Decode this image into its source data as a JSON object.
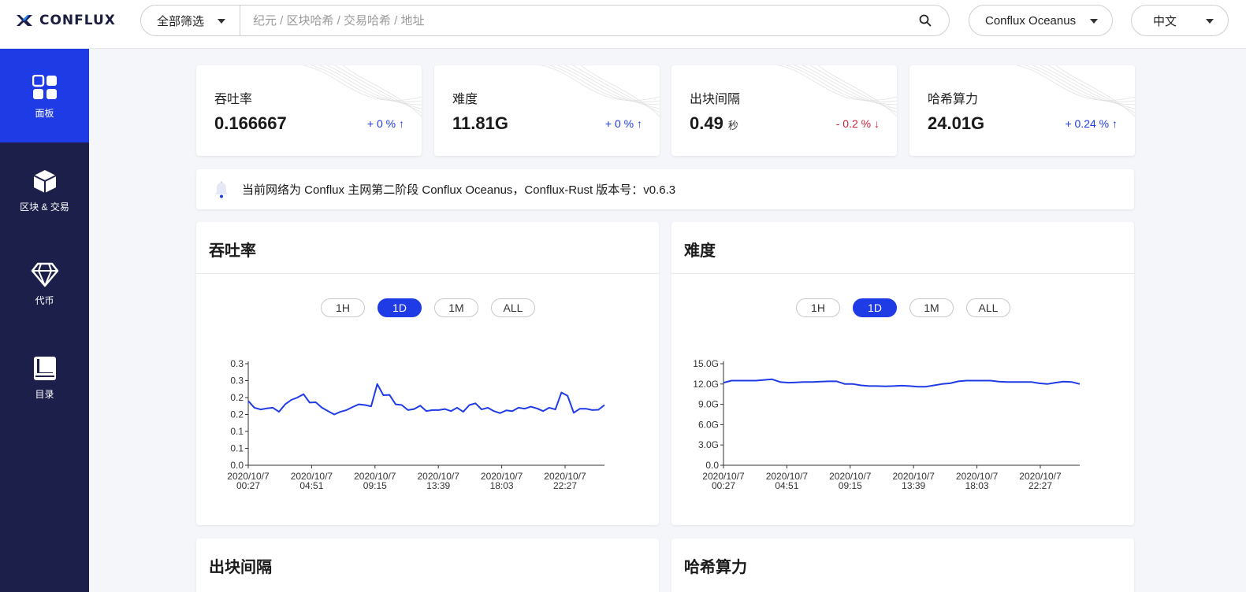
{
  "header": {
    "logo_text": "CONFLUX",
    "search_filter": "全部筛选",
    "search_placeholder": "纪元 / 区块哈希 / 交易哈希 / 地址",
    "network": "Conflux Oceanus",
    "language": "中文"
  },
  "sidebar": {
    "items": [
      {
        "label": "面板",
        "icon": "dashboard-icon",
        "active": true
      },
      {
        "label": "区块 & 交易",
        "icon": "cube-icon",
        "active": false
      },
      {
        "label": "代币",
        "icon": "diamond-icon",
        "active": false
      },
      {
        "label": "目录",
        "icon": "book-icon",
        "active": false
      }
    ]
  },
  "stats": [
    {
      "label": "吞吐率",
      "value": "0.166667",
      "unit": "",
      "change": "+ 0 % ↑",
      "direction": "up"
    },
    {
      "label": "难度",
      "value": "11.81G",
      "unit": "",
      "change": "+ 0 % ↑",
      "direction": "up"
    },
    {
      "label": "出块间隔",
      "value": "0.49",
      "unit": "秒",
      "change": "- 0.2 % ↓",
      "direction": "down"
    },
    {
      "label": "哈希算力",
      "value": "24.01G",
      "unit": "",
      "change": "+ 0.24 % ↑",
      "direction": "up"
    }
  ],
  "notice": {
    "text": "当前网络为 Conflux 主网第二阶段 Conflux Oceanus，Conflux-Rust 版本号：v0.6.3"
  },
  "range_buttons": [
    "1H",
    "1D",
    "1M",
    "ALL"
  ],
  "active_range": "1D",
  "panels": {
    "tps_title": "吞吐率",
    "difficulty_title": "难度",
    "blocktime_title": "出块间隔",
    "hashrate_title": "哈希算力"
  },
  "colors": {
    "accent": "#1f3be6",
    "sidebar_bg": "#1c1f4a",
    "down": "#c9233b"
  },
  "chart_data": [
    {
      "type": "line",
      "title": "吞吐率",
      "x_tick_labels": [
        [
          "2020/10/7",
          "00:27"
        ],
        [
          "2020/10/7",
          "04:51"
        ],
        [
          "2020/10/7",
          "09:15"
        ],
        [
          "2020/10/7",
          "13:39"
        ],
        [
          "2020/10/7",
          "18:03"
        ],
        [
          "2020/10/7",
          "22:27"
        ]
      ],
      "y_tick_labels": [
        "0.0",
        "0.1",
        "0.1",
        "0.2",
        "0.2",
        "0.3",
        "0.3"
      ],
      "ylim": [
        0,
        0.3
      ],
      "grid": false,
      "series": [
        {
          "values": [
            0.19,
            0.17,
            0.165,
            0.168,
            0.17,
            0.158,
            0.18,
            0.193,
            0.2,
            0.21,
            0.185,
            0.186,
            0.17,
            0.16,
            0.15,
            0.158,
            0.163,
            0.172,
            0.18,
            0.178,
            0.174,
            0.24,
            0.207,
            0.208,
            0.18,
            0.178,
            0.163,
            0.166,
            0.176,
            0.16,
            0.163,
            0.163,
            0.166,
            0.16,
            0.17,
            0.158,
            0.178,
            0.183,
            0.165,
            0.17,
            0.16,
            0.154,
            0.162,
            0.16,
            0.17,
            0.167,
            0.173,
            0.168,
            0.16,
            0.17,
            0.165,
            0.215,
            0.205,
            0.155,
            0.167,
            0.167,
            0.163,
            0.164,
            0.178
          ]
        }
      ]
    },
    {
      "type": "line",
      "title": "难度",
      "x_tick_labels": [
        [
          "2020/10/7",
          "00:27"
        ],
        [
          "2020/10/7",
          "04:51"
        ],
        [
          "2020/10/7",
          "09:15"
        ],
        [
          "2020/10/7",
          "13:39"
        ],
        [
          "2020/10/7",
          "18:03"
        ],
        [
          "2020/10/7",
          "22:27"
        ]
      ],
      "y_tick_labels": [
        "0.0",
        "3.0G",
        "6.0G",
        "9.0G",
        "12.0G",
        "15.0G"
      ],
      "ylim": [
        0,
        15
      ],
      "grid": false,
      "series": [
        {
          "values": [
            12.2,
            12.5,
            12.5,
            12.5,
            12.5,
            12.6,
            12.7,
            12.3,
            12.2,
            12.25,
            12.3,
            12.3,
            12.35,
            12.4,
            12.4,
            12.0,
            12.0,
            11.8,
            11.7,
            11.7,
            11.65,
            11.7,
            11.75,
            11.7,
            11.6,
            11.6,
            11.8,
            12.0,
            12.1,
            12.4,
            12.5,
            12.5,
            12.5,
            12.5,
            12.35,
            12.3,
            12.3,
            12.3,
            12.3,
            12.1,
            12.0,
            12.2,
            12.35,
            12.3,
            12.0
          ]
        }
      ]
    }
  ]
}
